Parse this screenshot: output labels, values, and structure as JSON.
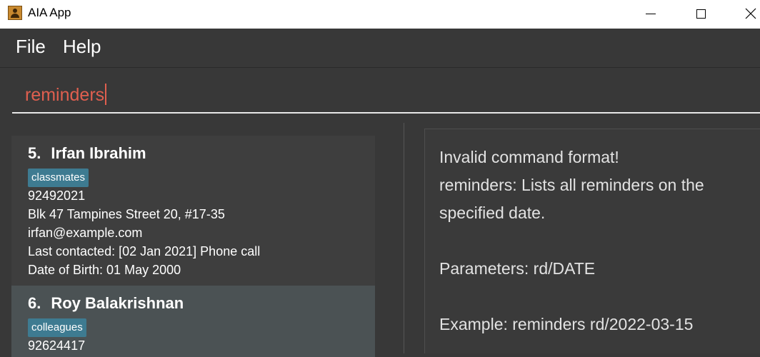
{
  "window": {
    "title": "AIA App",
    "icons": {
      "app": "contact-book-icon",
      "minimize": "minimize-icon",
      "maximize": "maximize-icon",
      "close": "close-icon"
    }
  },
  "menu": {
    "file": "File",
    "help": "Help"
  },
  "command": {
    "value": "reminders"
  },
  "persons": [
    {
      "index": "5.",
      "name": "Irfan Ibrahim",
      "tag": "classmates",
      "phone": "92492021",
      "address": "Blk 47 Tampines Street 20, #17-35",
      "email": "irfan@example.com",
      "last_contacted": "Last contacted: [02 Jan 2021] Phone call",
      "birthday": "Date of Birth: 01 May 2000"
    },
    {
      "index": "6.",
      "name": "Roy Balakrishnan",
      "tag": "colleagues",
      "phone": "92624417"
    }
  ],
  "result": {
    "line1": "Invalid command format!",
    "line2": "reminders: Lists all reminders on the",
    "line3": "specified date.",
    "line4": "Parameters: rd/DATE",
    "line5": "Example: reminders rd/2022-03-15"
  },
  "colors": {
    "background": "#383838",
    "command_text": "#e05f4f",
    "tag": "#3e7b91",
    "selected_card": "#4b5254"
  }
}
